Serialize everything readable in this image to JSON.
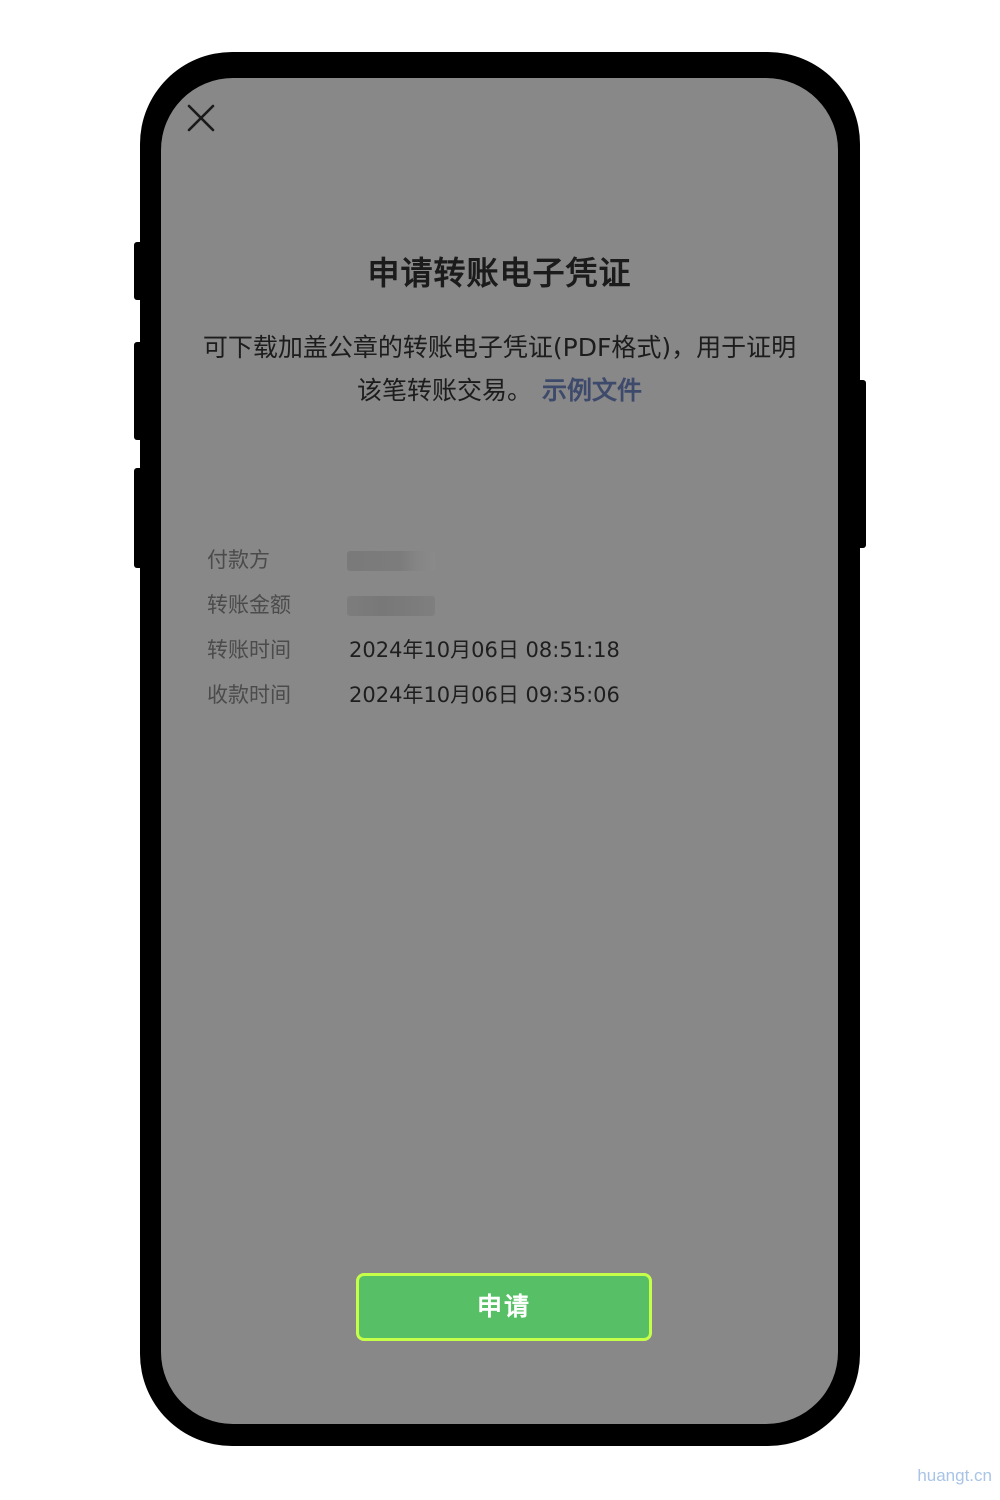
{
  "dialog": {
    "close_icon": "close-icon",
    "title": "申请转账电子凭证",
    "description": "可下载加盖公章的转账电子凭证(PDF格式)，用于证明该笔转账交易。",
    "example_link": "示例文件",
    "info_rows": [
      {
        "label": "付款方",
        "value": "",
        "blurred": true
      },
      {
        "label": "转账金额",
        "value": "",
        "blurred": true
      },
      {
        "label": "转账时间",
        "value": "2024年10月06日 08:51:18"
      },
      {
        "label": "收款时间",
        "value": "2024年10月06日 09:35:06"
      }
    ],
    "apply_button": "申请"
  },
  "watermark": "huangt.cn",
  "colors": {
    "screen_overlay": "#888888",
    "button_green": "#57c066",
    "button_border": "#c6ff4a",
    "link": "#3e4a6b",
    "watermark": "#a8c4e6"
  }
}
